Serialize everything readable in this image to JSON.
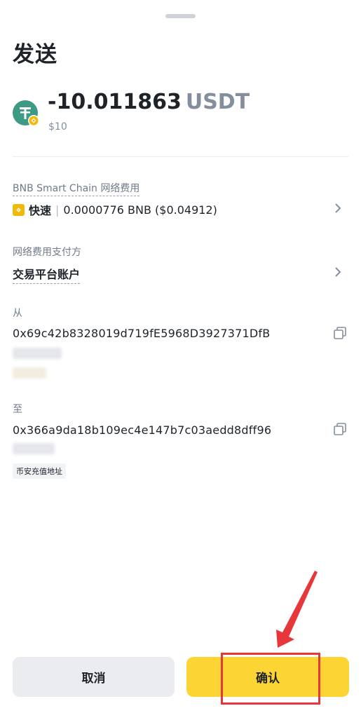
{
  "sheet": {
    "title": "发送"
  },
  "transfer": {
    "amount": "-10.011863",
    "symbol": "USDT",
    "fiat_value": "$10"
  },
  "network_fee": {
    "label": "BNB Smart Chain 网络费用",
    "speed": "快速",
    "separator": "|",
    "amount": "0.0000776 BNB ($0.04912)"
  },
  "fee_payer": {
    "label": "网络费用支付方",
    "value": "交易平台账户"
  },
  "from": {
    "label": "从",
    "address": "0x69c42b8328019d719fE5968D3927371DfB"
  },
  "to": {
    "label": "至",
    "address": "0x366a9da18b109ec4e147b7c03aedd8dff96",
    "tag": "币安充值地址"
  },
  "actions": {
    "cancel_label": "取消",
    "confirm_label": "确认"
  },
  "colors": {
    "accent": "#fcd535",
    "annotation": "#e8373a",
    "usdt": "#26a17b",
    "bnb": "#f0b90b"
  }
}
